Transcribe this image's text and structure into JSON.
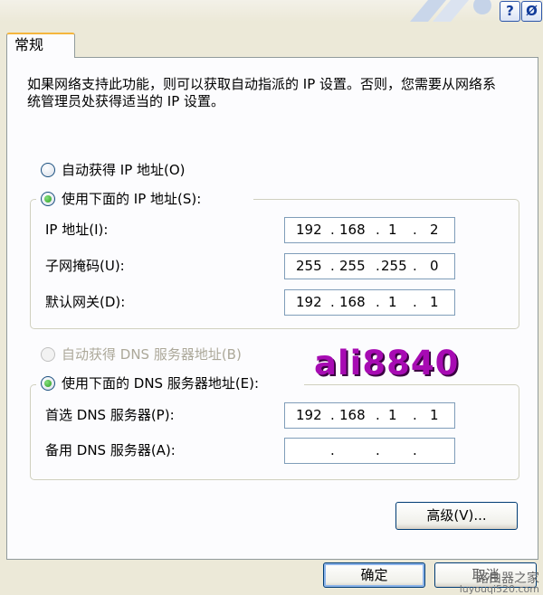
{
  "titlebar": {
    "help_glyph": "?",
    "close_glyph": "Ø"
  },
  "tab": {
    "label": "常规"
  },
  "description": "如果网络支持此功能，则可以获取自动指派的 IP 设置。否则，您需要从网络系统管理员处获得适当的 IP 设置。",
  "ip_mode": {
    "auto_label": "自动获得 IP 地址(O)",
    "manual_label": "使用下面的 IP 地址(S):",
    "selected": "manual"
  },
  "ip_fields": [
    {
      "label": "IP 地址(I):",
      "octets": [
        "192",
        "168",
        "1",
        "2"
      ]
    },
    {
      "label": "子网掩码(U):",
      "octets": [
        "255",
        "255",
        "255",
        "0"
      ]
    },
    {
      "label": "默认网关(D):",
      "octets": [
        "192",
        "168",
        "1",
        "1"
      ]
    }
  ],
  "dns_mode": {
    "auto_label": "自动获得 DNS 服务器地址(B)",
    "manual_label": "使用下面的 DNS 服务器地址(E):",
    "selected": "manual",
    "auto_disabled": true
  },
  "dns_fields": [
    {
      "label": "首选 DNS 服务器(P):",
      "octets": [
        "192",
        "168",
        "1",
        "1"
      ]
    },
    {
      "label": "备用 DNS 服务器(A):",
      "octets": [
        "",
        "",
        "",
        ""
      ]
    }
  ],
  "buttons": {
    "advanced": "高级(V)...",
    "ok": "确定",
    "cancel": "取消"
  },
  "watermark": "ali8840",
  "corner_watermark": {
    "line1": "路由器之家",
    "line2": "luyouqi520.com"
  },
  "colors": {
    "accent_tab": "#f5b63d",
    "watermark": "#a70bb3",
    "radio_selected": "#2a9d1c"
  }
}
